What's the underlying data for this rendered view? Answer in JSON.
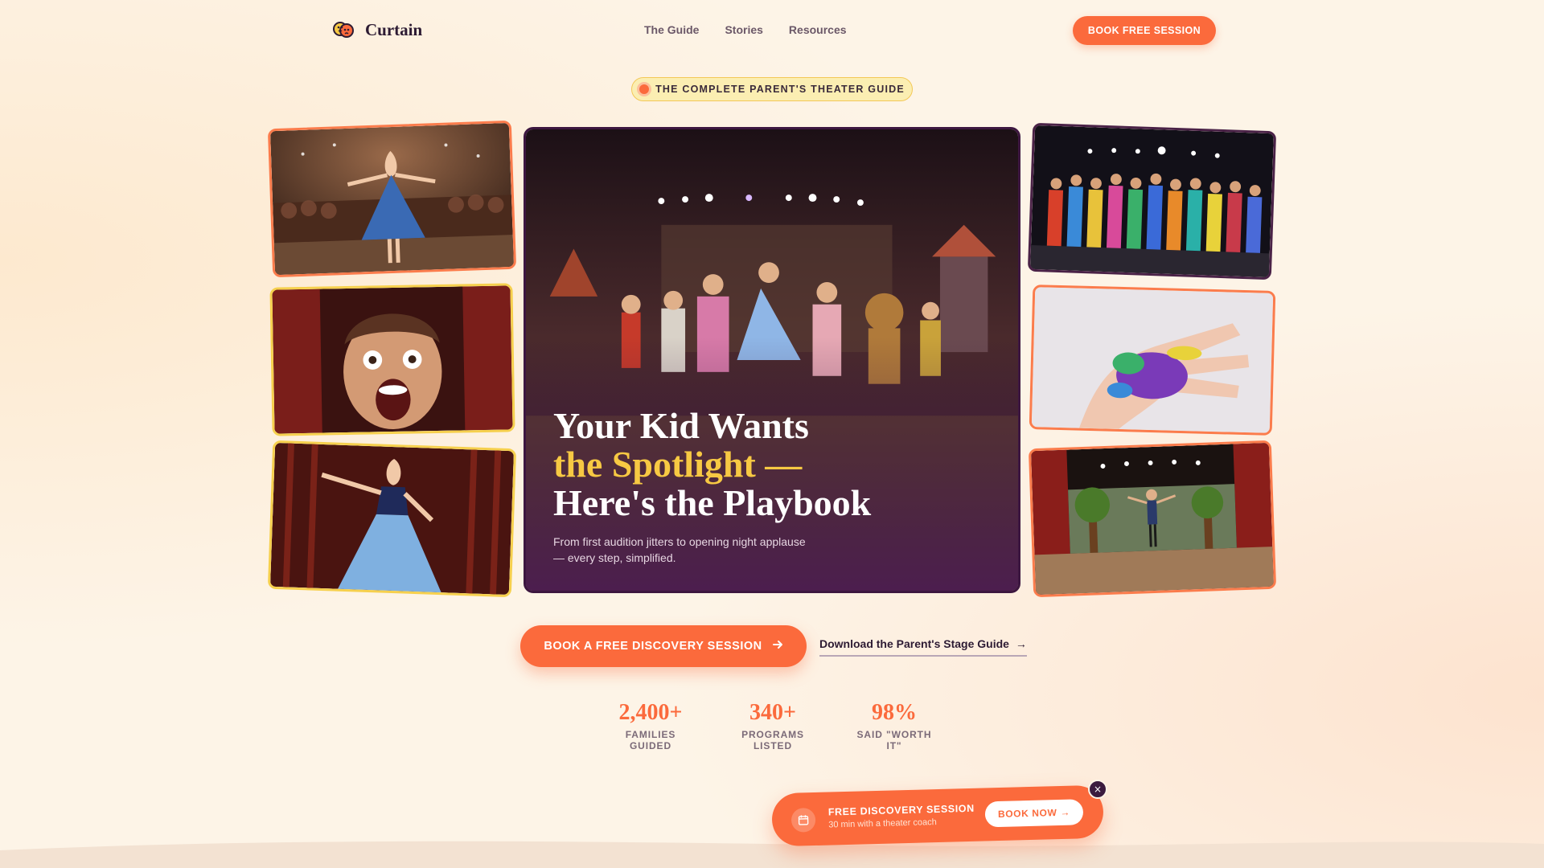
{
  "brand": {
    "name": "Curtain"
  },
  "nav": {
    "links": [
      "The Guide",
      "Stories",
      "Resources"
    ],
    "cta": "BOOK FREE SESSION"
  },
  "badge": {
    "text": "THE COMPLETE PARENT'S THEATER GUIDE"
  },
  "hero": {
    "title_line1": "Your Kid Wants",
    "title_line2": "the Spotlight —",
    "title_line3": "Here's the Playbook",
    "subtitle": "From first audition jitters to opening night applause — every step, simplified."
  },
  "cta": {
    "primary": "BOOK A FREE DISCOVERY SESSION",
    "secondary": "Download the Parent's Stage Guide",
    "secondary_arrow": "→"
  },
  "stats": [
    {
      "value": "2,400+",
      "label": "FAMILIES GUIDED"
    },
    {
      "value": "340+",
      "label": "PROGRAMS LISTED"
    },
    {
      "value": "98%",
      "label": "SAID \"WORTH IT\""
    }
  ],
  "floating_cta": {
    "title": "FREE DISCOVERY SESSION",
    "subtitle": "30 min with a theater coach",
    "button": "BOOK NOW →",
    "close": "×"
  },
  "colors": {
    "accent": "#fb6a3c",
    "highlight": "#f7c943",
    "plum": "#3d1740",
    "background": "#fdf4e7"
  },
  "icons": [
    "curtain-logo-icon",
    "arrow-right-icon",
    "calendar-icon",
    "close-icon"
  ]
}
